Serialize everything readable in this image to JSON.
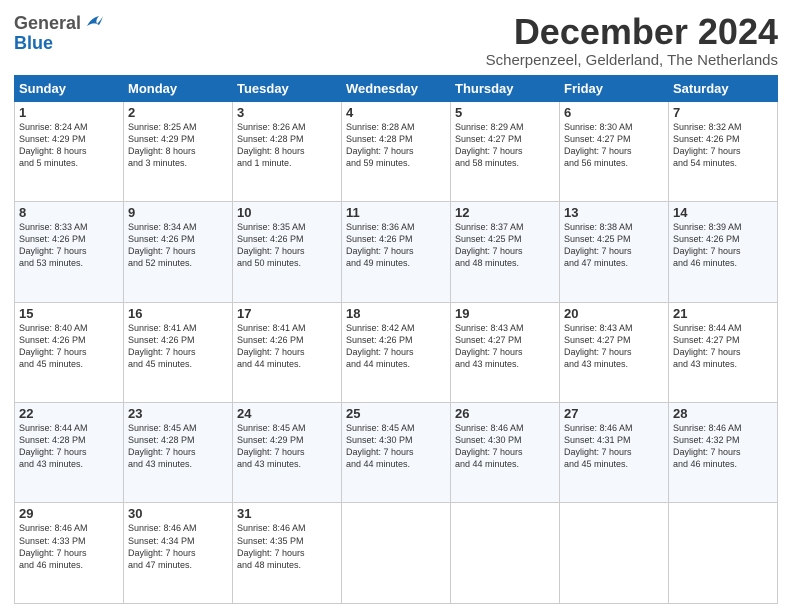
{
  "logo": {
    "general": "General",
    "blue": "Blue"
  },
  "header": {
    "title": "December 2024",
    "subtitle": "Scherpenzeel, Gelderland, The Netherlands"
  },
  "weekdays": [
    "Sunday",
    "Monday",
    "Tuesday",
    "Wednesday",
    "Thursday",
    "Friday",
    "Saturday"
  ],
  "weeks": [
    [
      {
        "day": "1",
        "info": "Sunrise: 8:24 AM\nSunset: 4:29 PM\nDaylight: 8 hours\nand 5 minutes."
      },
      {
        "day": "2",
        "info": "Sunrise: 8:25 AM\nSunset: 4:29 PM\nDaylight: 8 hours\nand 3 minutes."
      },
      {
        "day": "3",
        "info": "Sunrise: 8:26 AM\nSunset: 4:28 PM\nDaylight: 8 hours\nand 1 minute."
      },
      {
        "day": "4",
        "info": "Sunrise: 8:28 AM\nSunset: 4:28 PM\nDaylight: 7 hours\nand 59 minutes."
      },
      {
        "day": "5",
        "info": "Sunrise: 8:29 AM\nSunset: 4:27 PM\nDaylight: 7 hours\nand 58 minutes."
      },
      {
        "day": "6",
        "info": "Sunrise: 8:30 AM\nSunset: 4:27 PM\nDaylight: 7 hours\nand 56 minutes."
      },
      {
        "day": "7",
        "info": "Sunrise: 8:32 AM\nSunset: 4:26 PM\nDaylight: 7 hours\nand 54 minutes."
      }
    ],
    [
      {
        "day": "8",
        "info": "Sunrise: 8:33 AM\nSunset: 4:26 PM\nDaylight: 7 hours\nand 53 minutes."
      },
      {
        "day": "9",
        "info": "Sunrise: 8:34 AM\nSunset: 4:26 PM\nDaylight: 7 hours\nand 52 minutes."
      },
      {
        "day": "10",
        "info": "Sunrise: 8:35 AM\nSunset: 4:26 PM\nDaylight: 7 hours\nand 50 minutes."
      },
      {
        "day": "11",
        "info": "Sunrise: 8:36 AM\nSunset: 4:26 PM\nDaylight: 7 hours\nand 49 minutes."
      },
      {
        "day": "12",
        "info": "Sunrise: 8:37 AM\nSunset: 4:25 PM\nDaylight: 7 hours\nand 48 minutes."
      },
      {
        "day": "13",
        "info": "Sunrise: 8:38 AM\nSunset: 4:25 PM\nDaylight: 7 hours\nand 47 minutes."
      },
      {
        "day": "14",
        "info": "Sunrise: 8:39 AM\nSunset: 4:26 PM\nDaylight: 7 hours\nand 46 minutes."
      }
    ],
    [
      {
        "day": "15",
        "info": "Sunrise: 8:40 AM\nSunset: 4:26 PM\nDaylight: 7 hours\nand 45 minutes."
      },
      {
        "day": "16",
        "info": "Sunrise: 8:41 AM\nSunset: 4:26 PM\nDaylight: 7 hours\nand 45 minutes."
      },
      {
        "day": "17",
        "info": "Sunrise: 8:41 AM\nSunset: 4:26 PM\nDaylight: 7 hours\nand 44 minutes."
      },
      {
        "day": "18",
        "info": "Sunrise: 8:42 AM\nSunset: 4:26 PM\nDaylight: 7 hours\nand 44 minutes."
      },
      {
        "day": "19",
        "info": "Sunrise: 8:43 AM\nSunset: 4:27 PM\nDaylight: 7 hours\nand 43 minutes."
      },
      {
        "day": "20",
        "info": "Sunrise: 8:43 AM\nSunset: 4:27 PM\nDaylight: 7 hours\nand 43 minutes."
      },
      {
        "day": "21",
        "info": "Sunrise: 8:44 AM\nSunset: 4:27 PM\nDaylight: 7 hours\nand 43 minutes."
      }
    ],
    [
      {
        "day": "22",
        "info": "Sunrise: 8:44 AM\nSunset: 4:28 PM\nDaylight: 7 hours\nand 43 minutes."
      },
      {
        "day": "23",
        "info": "Sunrise: 8:45 AM\nSunset: 4:28 PM\nDaylight: 7 hours\nand 43 minutes."
      },
      {
        "day": "24",
        "info": "Sunrise: 8:45 AM\nSunset: 4:29 PM\nDaylight: 7 hours\nand 43 minutes."
      },
      {
        "day": "25",
        "info": "Sunrise: 8:45 AM\nSunset: 4:30 PM\nDaylight: 7 hours\nand 44 minutes."
      },
      {
        "day": "26",
        "info": "Sunrise: 8:46 AM\nSunset: 4:30 PM\nDaylight: 7 hours\nand 44 minutes."
      },
      {
        "day": "27",
        "info": "Sunrise: 8:46 AM\nSunset: 4:31 PM\nDaylight: 7 hours\nand 45 minutes."
      },
      {
        "day": "28",
        "info": "Sunrise: 8:46 AM\nSunset: 4:32 PM\nDaylight: 7 hours\nand 46 minutes."
      }
    ],
    [
      {
        "day": "29",
        "info": "Sunrise: 8:46 AM\nSunset: 4:33 PM\nDaylight: 7 hours\nand 46 minutes."
      },
      {
        "day": "30",
        "info": "Sunrise: 8:46 AM\nSunset: 4:34 PM\nDaylight: 7 hours\nand 47 minutes."
      },
      {
        "day": "31",
        "info": "Sunrise: 8:46 AM\nSunset: 4:35 PM\nDaylight: 7 hours\nand 48 minutes."
      },
      null,
      null,
      null,
      null
    ]
  ]
}
